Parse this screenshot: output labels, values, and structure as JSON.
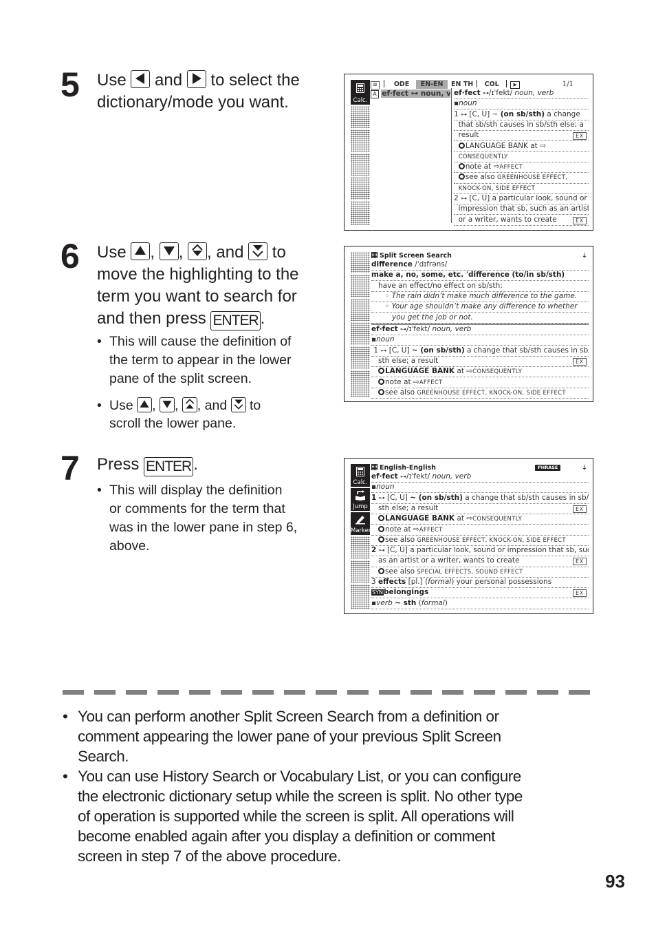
{
  "steps": [
    {
      "number": "5",
      "text_parts": [
        "Use",
        "and",
        "to select the",
        "dictionary/mode you want."
      ],
      "keys": [
        "left-arrow-key",
        "right-arrow-key"
      ]
    },
    {
      "number": "6",
      "text_parts": [
        "Use",
        ",",
        ",",
        ", and",
        "to",
        "move the highlighting to the",
        "term you want to search for",
        "and then press",
        "."
      ],
      "keys": [
        "up-arrow-key",
        "down-arrow-key",
        "page-up-key",
        "page-down-key",
        "enter-key"
      ],
      "enter_label": "ENTER",
      "bullets": [
        {
          "lines": [
            "This will cause the definition of",
            "the term to appear in the lower",
            "pane of the split screen."
          ]
        },
        {
          "parts": [
            "Use",
            ",",
            ",",
            ", and",
            "to"
          ],
          "line2": "scroll the lower pane."
        }
      ]
    },
    {
      "number": "7",
      "text_parts": [
        "Press",
        "."
      ],
      "enter_label": "ENTER",
      "bullets": [
        {
          "lines": [
            "This will display the definition",
            "or comments for the term that",
            "was in the lower pane in step 6,",
            "above."
          ]
        }
      ]
    }
  ],
  "screen1": {
    "tabs": [
      "ODE",
      "EN-EN",
      "EN TH",
      "COL"
    ],
    "active_tab": "EN-EN",
    "page": "1/1",
    "sidebar_button": "Calc.",
    "list_item_letter": "A",
    "list_item": "ef·fect ⊶ noun, ve",
    "lines": [
      {
        "html": "<span class='b'>ef·fect</span> <span class='key-icon'>⊶</span>/ɪˈfekt/ <span class='i'>noun, verb</span>"
      },
      {
        "html": "▪<span class='i'>noun</span>"
      },
      {
        "html": "1 <span class='key-icon'>⊶</span> [C, U] ~ <span class='b'>(on sb/sth)</span> a change"
      },
      {
        "html": "&nbsp;&nbsp;that sb/sth causes in sb/sth else; a"
      },
      {
        "html": "&nbsp;&nbsp;result",
        "ex": true
      },
      {
        "html": "&nbsp;&nbsp;<span class='circ'></span>LANGUAGE BANK at ⇨"
      },
      {
        "html": "&nbsp;&nbsp;<span class='sc'>CONSEQUENTLY</span>"
      },
      {
        "html": "&nbsp;&nbsp;<span class='circ'></span>note at ⇨<span class='sc'>AFFECT</span>"
      },
      {
        "html": "&nbsp;&nbsp;<span class='circ'></span>see also <span class='sc'>GREENHOUSE EFFECT,</span>"
      },
      {
        "html": "&nbsp;&nbsp;<span class='sc'>KNOCK-ON, SIDE EFFECT</span>"
      },
      {
        "html": "2 <span class='key-icon'>⊶</span> [C, U] a particular look, sound or"
      },
      {
        "html": "&nbsp;&nbsp;impression that sb, such as an artist"
      },
      {
        "html": "&nbsp;&nbsp;or a writer, wants to create",
        "ex": true
      }
    ],
    "ex_label": "EX"
  },
  "screen2": {
    "title": "Split Screen Search",
    "upper_lines": [
      {
        "html": "<span class='b'>difference</span> /ˈdɪfrəns/"
      },
      {
        "html": "<span class='b'>make a, no, some, etc. ˈdifference (to/in sb/sth)</span>"
      },
      {
        "html": "&nbsp;&nbsp;&nbsp;have an effect/no effect on sb/sth:"
      },
      {
        "html": "&nbsp;&nbsp;&nbsp;&nbsp;&nbsp;&nbsp;◦ <span class='i'>The rain didn’t make much difference to the game.</span>"
      },
      {
        "html": "&nbsp;&nbsp;&nbsp;&nbsp;&nbsp;&nbsp;◦ <span class='i'>Your age shouldn’t make any difference to whether</span>"
      },
      {
        "html": "&nbsp;&nbsp;&nbsp;&nbsp;&nbsp;&nbsp;&nbsp;&nbsp;&nbsp;<span class='i'>you get the job or not.</span>"
      }
    ],
    "lower_lines": [
      {
        "html": "<span class='b'>ef·fect</span> <span class='key-icon'>⊶</span>/ɪˈfekt/ <span class='i'>noun, verb</span>"
      },
      {
        "html": "▪<span class='i'>noun</span>"
      },
      {
        "html": "&nbsp;1 <span class='key-icon'>⊶</span> [C, U] <span class='b'>~ (on sb/sth)</span> a change that sb/sth causes in sb/"
      },
      {
        "html": "&nbsp;&nbsp;&nbsp;sth else; a result",
        "ex": true
      },
      {
        "html": "&nbsp;&nbsp;&nbsp;<span class='circ'></span><span class='b'>LANGUAGE BANK</span> at ⇨<span class='sc'>CONSEQUENTLY</span>"
      },
      {
        "html": "&nbsp;&nbsp;&nbsp;<span class='circ'></span>note at ⇨<span class='sc'>AFFECT</span>"
      },
      {
        "html": "&nbsp;&nbsp;&nbsp;<span class='circ'></span>see also <span class='sc'>GREENHOUSE EFFECT, KNOCK-ON, SIDE EFFECT</span>"
      }
    ],
    "ex_label": "EX"
  },
  "screen3": {
    "title": "English-English",
    "badge": "PHRASE",
    "sidebar_buttons": [
      "Calc.",
      "Jump",
      "Marker"
    ],
    "lines": [
      {
        "html": "<span class='b'>ef·fect</span> <span class='key-icon'>⊶</span>/ɪˈfekt/ <span class='i'>noun, verb</span>"
      },
      {
        "html": "▪<span class='i'>noun</span>"
      },
      {
        "html": "<span class='b'>1</span> <span class='key-icon'>⊶</span> [C, U] <span class='b'>~ (on sb/sth)</span> a change that sb/sth causes in sb/"
      },
      {
        "html": "&nbsp;&nbsp;&nbsp;sth else; a result",
        "ex": true
      },
      {
        "html": "&nbsp;&nbsp;&nbsp;<span class='circ'></span><span class='b'>LANGUAGE BANK</span> at ⇨<span class='sc'>CONSEQUENTLY</span>"
      },
      {
        "html": "&nbsp;&nbsp;&nbsp;<span class='circ'></span>note at ⇨<span class='sc'>AFFECT</span>"
      },
      {
        "html": "&nbsp;&nbsp;&nbsp;<span class='circ'></span>see also <span class='sc'>GREENHOUSE EFFECT, KNOCK-ON, SIDE EFFECT</span>"
      },
      {
        "html": "<span class='b'>2</span> <span class='key-icon'>⊶</span> [C, U] a particular look, sound or impression that sb, such"
      },
      {
        "html": "&nbsp;&nbsp;&nbsp;as an artist or a writer, wants to create",
        "ex": true
      },
      {
        "html": "&nbsp;&nbsp;&nbsp;<span class='circ'></span>see also <span class='sc'>SPECIAL EFFECTS, SOUND EFFECT</span>"
      },
      {
        "html": "3 <span class='b'>effects</span> [pl.] (<span class='i'>formal</span>) your personal possessions"
      },
      {
        "html": "<span style='background:#222;color:#fff;font-size:8px;padding:0 1px;'>SYN</span><span class='b'>belongings</span>",
        "ex": true
      },
      {
        "html": "▪<span class='i'>verb</span> <span class='b'>~ sth</span> (<span class='i'>formal</span>)"
      }
    ],
    "ex_label": "EX"
  },
  "notes": [
    [
      "You can perform another Split Screen Search from a definition or",
      "comment appearing the lower pane of your previous Split Screen",
      "Search."
    ],
    [
      "You can use History Search or Vocabulary List, or you can configure",
      "the electronic dictionary setup while the screen is split. No other type",
      "of operation is supported while the screen is split. All operations will",
      "become enabled again after you display a definition or comment",
      "screen in step 7 of the above procedure."
    ]
  ],
  "page_number": "93"
}
